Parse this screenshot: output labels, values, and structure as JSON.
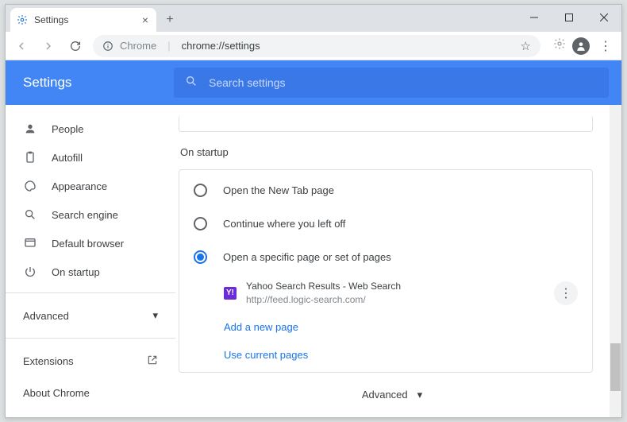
{
  "tab": {
    "title": "Settings"
  },
  "address": {
    "prefix": "Chrome",
    "url": "chrome://settings"
  },
  "header": {
    "title": "Settings",
    "search_placeholder": "Search settings"
  },
  "sidebar": {
    "items": [
      {
        "label": "People"
      },
      {
        "label": "Autofill"
      },
      {
        "label": "Appearance"
      },
      {
        "label": "Search engine"
      },
      {
        "label": "Default browser"
      },
      {
        "label": "On startup"
      }
    ],
    "advanced": "Advanced",
    "extensions": "Extensions",
    "about": "About Chrome"
  },
  "startup": {
    "title": "On startup",
    "opt1": "Open the New Tab page",
    "opt2": "Continue where you left off",
    "opt3": "Open a specific page or set of pages",
    "page_title": "Yahoo Search Results - Web Search",
    "page_url": "http://feed.logic-search.com/",
    "add_page": "Add a new page",
    "use_current": "Use current pages"
  },
  "footer": {
    "advanced": "Advanced"
  }
}
